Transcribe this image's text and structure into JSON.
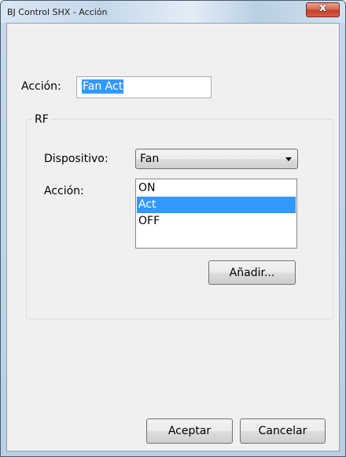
{
  "window": {
    "title": "BJ Control SHX - Acción",
    "close_glyph": "x"
  },
  "form": {
    "action_label": "Acción:",
    "action_value": "Fan Act"
  },
  "group": {
    "title": "RF",
    "device_label": "Dispositivo:",
    "device_value": "Fan",
    "action_label": "Acción:",
    "actions": [
      {
        "label": "ON",
        "selected": false
      },
      {
        "label": "Act",
        "selected": true
      },
      {
        "label": "OFF",
        "selected": false
      }
    ],
    "add_button": "Añadir..."
  },
  "footer": {
    "accept_button": "Aceptar",
    "cancel_button": "Cancelar"
  },
  "colors": {
    "selection": "#3399ff",
    "client_bg": "#f0f0f0",
    "close_red": "#c5402a"
  }
}
